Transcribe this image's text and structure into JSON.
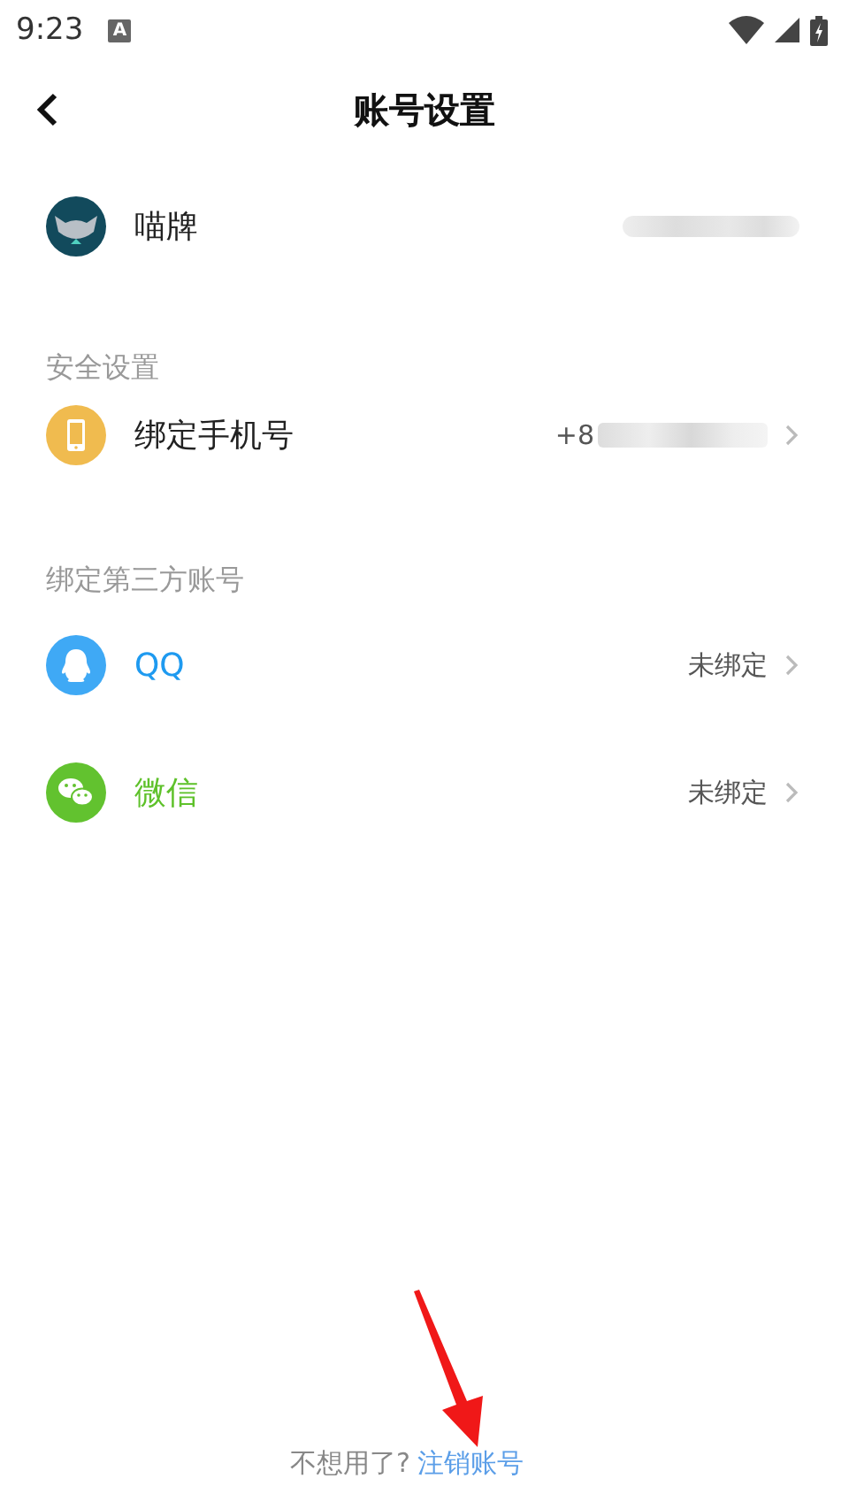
{
  "status_bar": {
    "time": "9:23",
    "notification": "A"
  },
  "header": {
    "title": "账号设置"
  },
  "profile": {
    "name": "喵牌"
  },
  "sections": [
    {
      "title": "安全设置",
      "rows": [
        {
          "kind": "phone",
          "label": "绑定手机号",
          "value": "+8",
          "color": "#222222"
        }
      ]
    },
    {
      "title": "绑定第三方账号",
      "rows": [
        {
          "kind": "qq",
          "label": "QQ",
          "value": "未绑定",
          "color": "#1e9af0"
        },
        {
          "kind": "wechat",
          "label": "微信",
          "value": "未绑定",
          "color": "#5ec12a"
        }
      ]
    }
  ],
  "footer": {
    "question": "不想用了?",
    "link": "注销账号"
  }
}
